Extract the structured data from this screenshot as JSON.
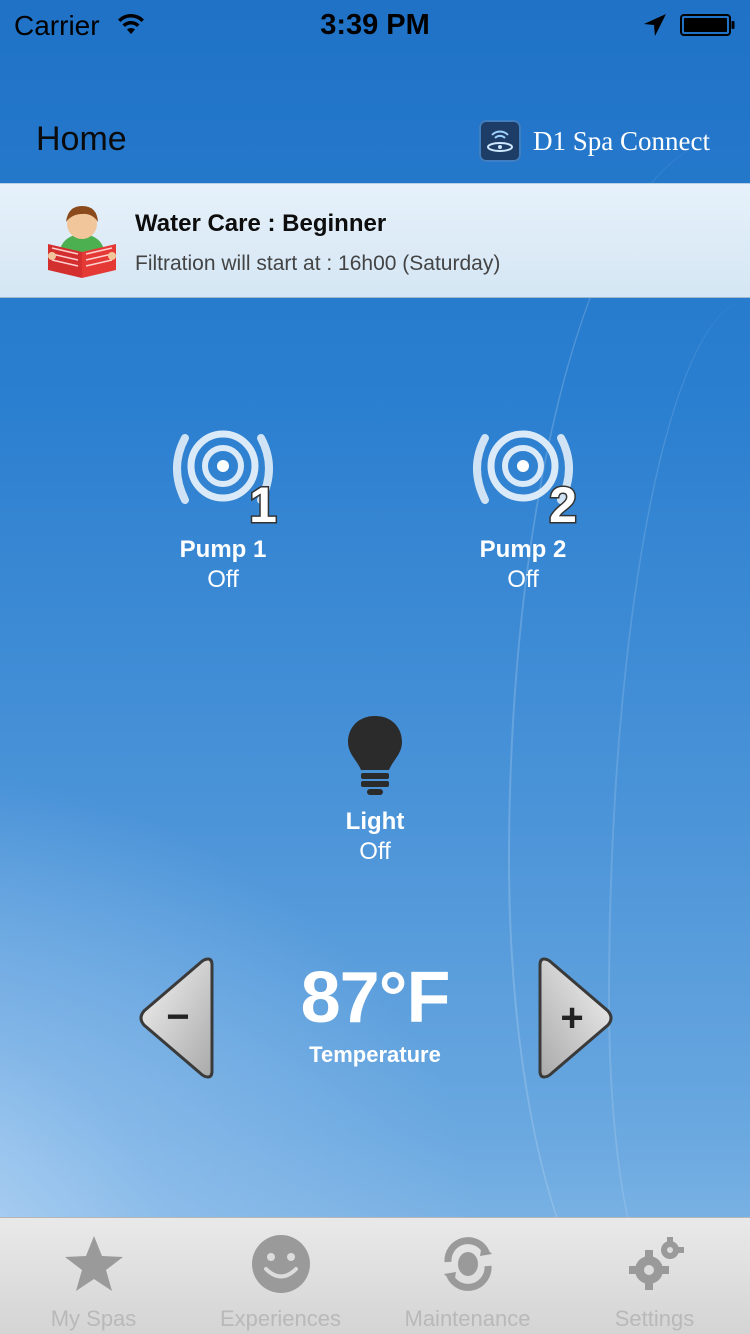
{
  "status_bar": {
    "carrier": "Carrier",
    "time": "3:39 PM"
  },
  "header": {
    "title": "Home",
    "brand": "D1 Spa Connect"
  },
  "banner": {
    "title": "Water Care : Beginner",
    "subtitle": "Filtration will start at : 16h00 (Saturday)"
  },
  "controls": {
    "pump1": {
      "label": "Pump 1",
      "state": "Off",
      "number": "1"
    },
    "pump2": {
      "label": "Pump 2",
      "state": "Off",
      "number": "2"
    },
    "light": {
      "label": "Light",
      "state": "Off"
    }
  },
  "temperature": {
    "value": "87°F",
    "label": "Temperature",
    "decrease_symbol": "−",
    "increase_symbol": "+"
  },
  "tabs": [
    {
      "label": "My Spas",
      "icon": "star-icon"
    },
    {
      "label": "Experiences",
      "icon": "smiley-icon"
    },
    {
      "label": "Maintenance",
      "icon": "maintenance-icon"
    },
    {
      "label": "Settings",
      "icon": "gears-icon"
    }
  ],
  "colors": {
    "background_top": "#1f72c6",
    "background_bottom": "#8cbde8",
    "banner": "#e6f1fa",
    "tab_bar": "#e0e0e0",
    "tab_inactive": "#b9b9b9"
  }
}
